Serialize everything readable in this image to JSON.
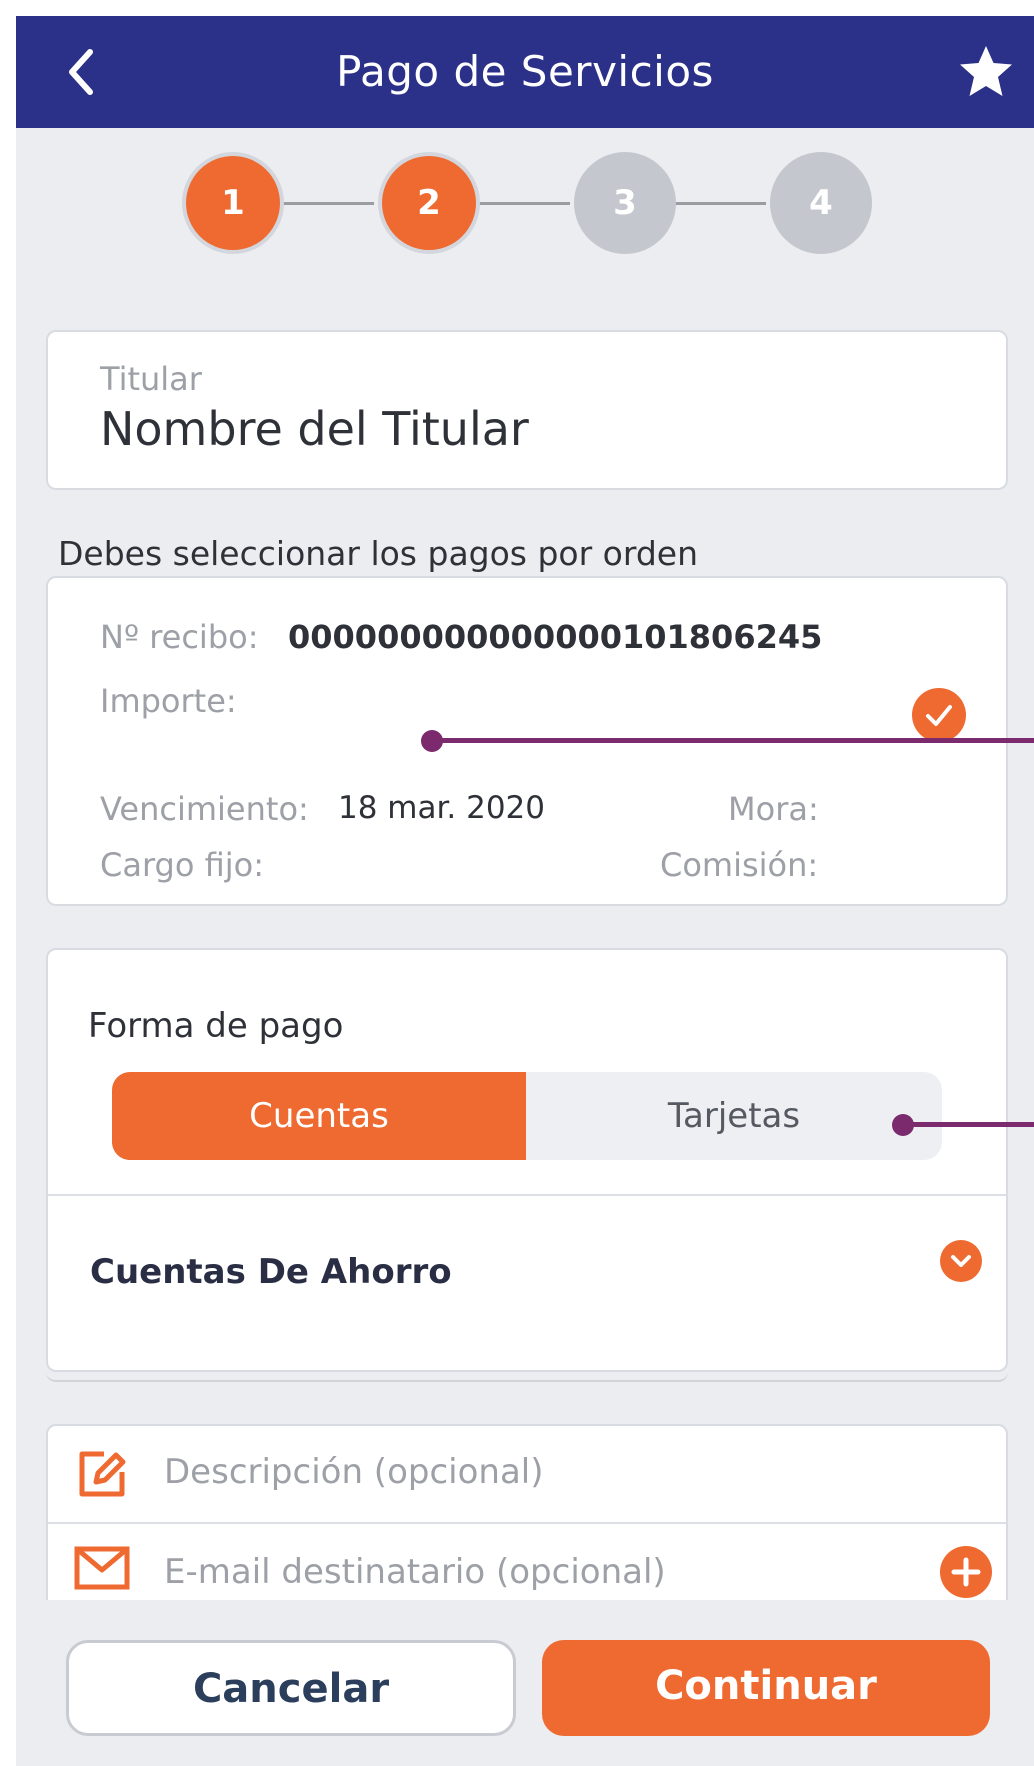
{
  "header": {
    "title": "Pago de Servicios",
    "back_icon": "chevron-left-icon",
    "favorite_icon": "star-icon"
  },
  "stepper": {
    "steps": [
      {
        "label": "1",
        "state": "active"
      },
      {
        "label": "2",
        "state": "active"
      },
      {
        "label": "3",
        "state": "inactive"
      },
      {
        "label": "4",
        "state": "inactive"
      }
    ]
  },
  "holder": {
    "label": "Titular",
    "value": "Nombre del Titular"
  },
  "instruction": "Debes seleccionar los pagos por orden",
  "receipt": {
    "number_label": "Nº recibo:",
    "number_value": "000000000000000101806245",
    "amount_label": "Importe:",
    "due_label": "Vencimiento:",
    "due_value": "18 mar. 2020",
    "late_label": "Mora:",
    "fixed_label": "Cargo fijo:",
    "fee_label": "Comisión:",
    "selected": true
  },
  "payment": {
    "title": "Forma de pago",
    "tabs": [
      "Cuentas",
      "Tarjetas"
    ],
    "selected_tab": "Cuentas",
    "account_type": "Cuentas De Ahorro"
  },
  "extras": {
    "description_placeholder": "Descripción (opcional)",
    "email_placeholder": "E-mail destinatario (opcional)"
  },
  "actions": {
    "cancel": "Cancelar",
    "continue": "Continuar"
  },
  "colors": {
    "header": "#2b3188",
    "accent": "#ef6a30",
    "background": "#ebedf1",
    "callout": "#7a2a6d"
  }
}
